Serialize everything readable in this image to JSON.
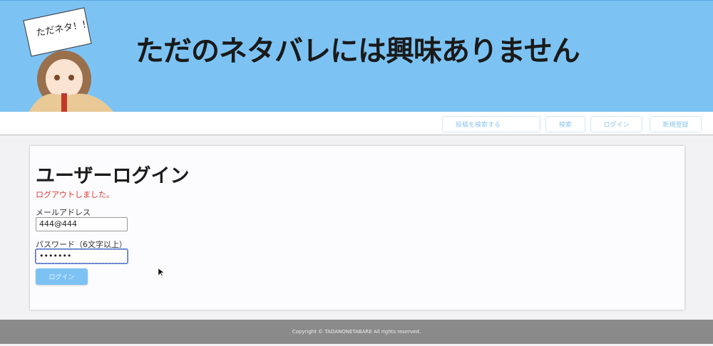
{
  "banner": {
    "title": "ただのネタバレには興味ありません",
    "sign": "ただネタ！！"
  },
  "nav": {
    "search_placeholder": "投稿を検索する",
    "search_button": "検索",
    "login": "ログイン",
    "signup": "新規登録"
  },
  "login": {
    "heading": "ユーザーログイン",
    "message": "ログアウトしました。",
    "email_label": "メールアドレス",
    "email_value": "444@444",
    "password_label": "パスワード（6文字以上）",
    "password_value": "•••••••",
    "submit": "ログイン"
  },
  "footer": {
    "copyright": "Copyright © TADANONETABARE All rights reserved."
  },
  "colors": {
    "brand": "#7cc3f4",
    "error": "#dd3333"
  }
}
